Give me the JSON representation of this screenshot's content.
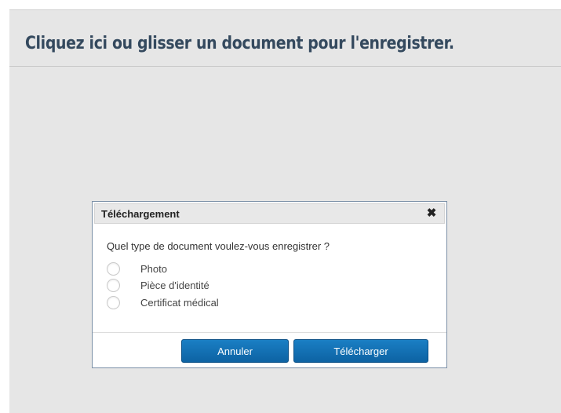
{
  "dropzone": {
    "title": "Cliquez ici ou glisser un document pour l'enregistrer."
  },
  "dialog": {
    "title": "Téléchargement",
    "close_icon": "close-icon",
    "close_glyph": "✖",
    "question": "Quel type de document voulez-vous enregistrer ?",
    "options": [
      {
        "label": "Photo",
        "selected": false
      },
      {
        "label": "Pièce d'identité",
        "selected": false
      },
      {
        "label": "Certificat médical",
        "selected": false
      }
    ],
    "buttons": {
      "cancel_label": "Annuler",
      "upload_label": "Télécharger"
    }
  },
  "colors": {
    "title_text": "#34495e",
    "background": "#e6e6e6",
    "button_primary": "#1172b8"
  }
}
